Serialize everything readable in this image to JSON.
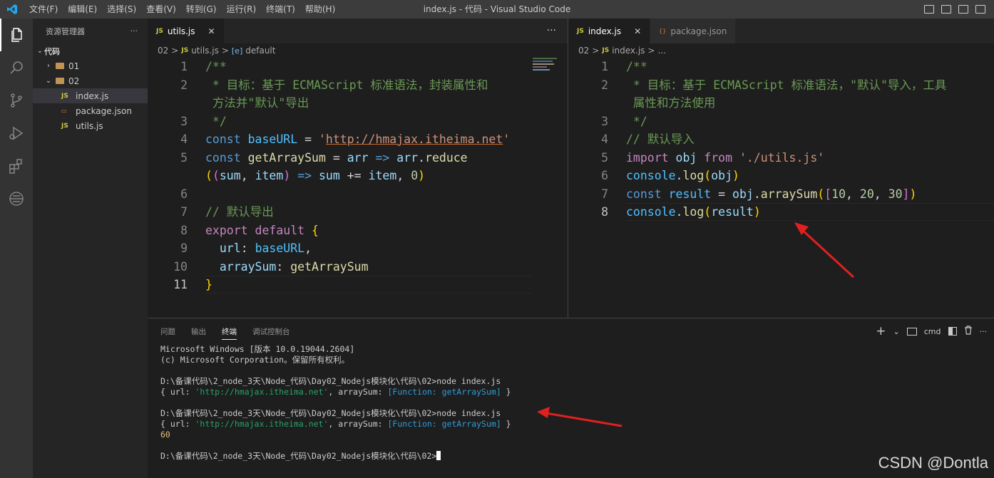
{
  "window": {
    "title": "index.js - 代码 - Visual Studio Code",
    "menu": [
      "文件(F)",
      "编辑(E)",
      "选择(S)",
      "查看(V)",
      "转到(G)",
      "运行(R)",
      "终端(T)",
      "帮助(H)"
    ]
  },
  "activity_bar": [
    "files-icon",
    "search-icon",
    "source-control-icon",
    "run-debug-icon",
    "extensions-icon",
    "remote-icon"
  ],
  "sidebar": {
    "title": "资源管理器",
    "more": "···",
    "root": "代码",
    "tree": [
      {
        "label": "01",
        "type": "folder",
        "expanded": false
      },
      {
        "label": "02",
        "type": "folder",
        "expanded": true
      },
      {
        "label": "index.js",
        "type": "js",
        "selected": true
      },
      {
        "label": "package.json",
        "type": "json"
      },
      {
        "label": "utils.js",
        "type": "js"
      }
    ]
  },
  "editor_left": {
    "tab": {
      "label": "utils.js",
      "icon": "JS",
      "close": "✕"
    },
    "more": "···",
    "breadcrumb": {
      "folder": "02",
      "sep": ">",
      "file": "utils.js",
      "symbol": "default"
    },
    "line_numbers": [
      "1",
      "2",
      "",
      "3",
      "4",
      "5",
      "",
      "6",
      "7",
      "8",
      "9",
      "10",
      "11"
    ],
    "current_line": "11",
    "code": {
      "l1": "/**",
      "l2a": " * 目标：基于 ECMAScript 标准语法，封装属性和",
      "l2b": " 方法并\"默认\"导出",
      "l3": " */",
      "l4_kw": "const",
      "l4_var": "baseURL",
      "l4_eq": " = ",
      "l4_q1": "'",
      "l4_str": "http://hmajax.itheima.net",
      "l4_q2": "'",
      "l5_kw": "const",
      "l5_fn": "getArraySum",
      "l5_eq": " = ",
      "l5_p": "arr",
      "l5_arrow": "=>",
      "l5_obj": "arr",
      "l5_dot": ".",
      "l5_m": "reduce",
      "l5b_p1": "(",
      "l5b_p2": "(",
      "l5b_a": "sum",
      "l5b_c": ", ",
      "l5b_b": "item",
      "l5b_p3": ")",
      "l5b_arrow": "=>",
      "l5b_s": "sum",
      "l5b_op": " += ",
      "l5b_i": "item",
      "l5b_c2": ", ",
      "l5b_n": "0",
      "l5b_p4": ")",
      "l7": "// 默认导出",
      "l8_ctl": "export",
      "l8_kw": "default",
      "l8_br": "{",
      "l9_k": "url",
      "l9_col": ": ",
      "l9_v": "baseURL",
      "l9_c": ",",
      "l10_k": "arraySum",
      "l10_col": ": ",
      "l10_v": "getArraySum",
      "l11_br": "}"
    }
  },
  "editor_right": {
    "tabs": [
      {
        "label": "index.js",
        "icon": "JS",
        "close": "✕",
        "active": true
      },
      {
        "label": "package.json",
        "icon": "{}",
        "active": false
      }
    ],
    "breadcrumb": {
      "folder": "02",
      "sep": ">",
      "file": "index.js",
      "rest": "..."
    },
    "line_numbers": [
      "1",
      "2",
      "",
      "3",
      "4",
      "5",
      "6",
      "7",
      "8"
    ],
    "current_line": "8",
    "code": {
      "l1": "/**",
      "l2a": " * 目标：基于 ECMAScript 标准语法，\"默认\"导入，工具",
      "l2b": " 属性和方法使用",
      "l3": " */",
      "l4": "// 默认导入",
      "l5_kw": "import",
      "l5_v": "obj",
      "l5_from": "from",
      "l5_str": "'./utils.js'",
      "l6_obj": "console",
      "l6_dot": ".",
      "l6_m": "log",
      "l6_p1": "(",
      "l6_a": "obj",
      "l6_p2": ")",
      "l7_kw": "const",
      "l7_v": "result",
      "l7_eq": " = ",
      "l7_obj": "obj",
      "l7_dot": ".",
      "l7_m": "arraySum",
      "l7_p1": "(",
      "l7_b1": "[",
      "l7_n1": "10",
      "l7_c1": ", ",
      "l7_n2": "20",
      "l7_c2": ", ",
      "l7_n3": "30",
      "l7_b2": "]",
      "l7_p2": ")",
      "l8_obj": "console",
      "l8_dot": ".",
      "l8_m": "log",
      "l8_p1": "(",
      "l8_a": "result",
      "l8_p2": ")"
    }
  },
  "panel": {
    "tabs": [
      "问题",
      "输出",
      "终端",
      "调试控制台"
    ],
    "active_tab": "终端",
    "actions": {
      "add": "+",
      "dropdown": "⌄",
      "shell": "cmd",
      "more": "···"
    },
    "terminal": {
      "l1": "Microsoft Windows [版本 10.0.19044.2604]",
      "l2": "(c) Microsoft Corporation。保留所有权利。",
      "prompt": "D:\\备课代码\\2_node_3天\\Node_代码\\Day02_Nodejs模块化\\代码\\02>",
      "cmd": "node index.js",
      "out_a": "{ url: ",
      "out_url": "'http://hmajax.itheima.net'",
      "out_b": ", arraySum: ",
      "out_fn": "[Function: getArraySum]",
      "out_c": " }",
      "result": "60"
    }
  },
  "watermark": "CSDN @Dontla",
  "colors": {
    "accent": "#007acc",
    "annotation_arrow": "#e02020"
  }
}
